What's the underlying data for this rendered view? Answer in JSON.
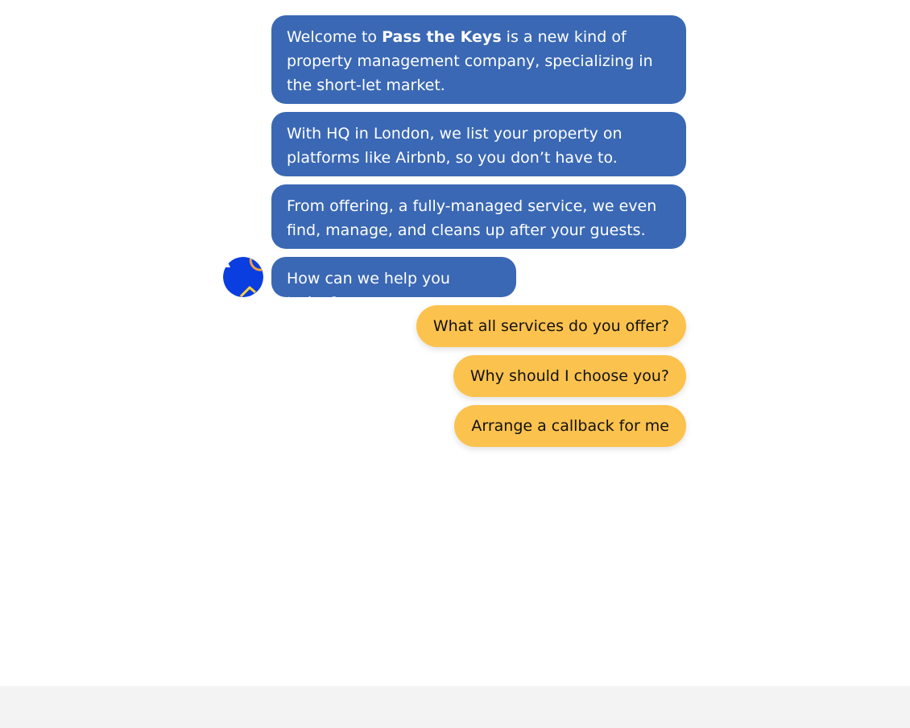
{
  "colors": {
    "bot_bubble": "#3a68b4",
    "option_button": "#fcc24e",
    "footer_bar": "#f3f3f3",
    "avatar_bg": "#0a3ee0",
    "avatar_accent_orange": "#f59e42",
    "avatar_accent_yellow": "#ffd23f"
  },
  "avatar": {
    "icon": "pass-the-keys-logo"
  },
  "messages": [
    {
      "before": "Welcome to ",
      "bold": "Pass the Keys",
      "after": " is a new kind of property management company, specializing in the short-let market."
    },
    {
      "text": "With HQ in London, we list your property on platforms like Airbnb, so you don’t have to."
    },
    {
      "text": "From offering, a fully-managed service, we even find, manage, and cleans up after your guests."
    },
    {
      "text": "How can we help you today?"
    }
  ],
  "options": [
    {
      "label": "What all services do you offer?"
    },
    {
      "label": "Why should I choose you?"
    },
    {
      "label": "Arrange a callback for me"
    }
  ]
}
